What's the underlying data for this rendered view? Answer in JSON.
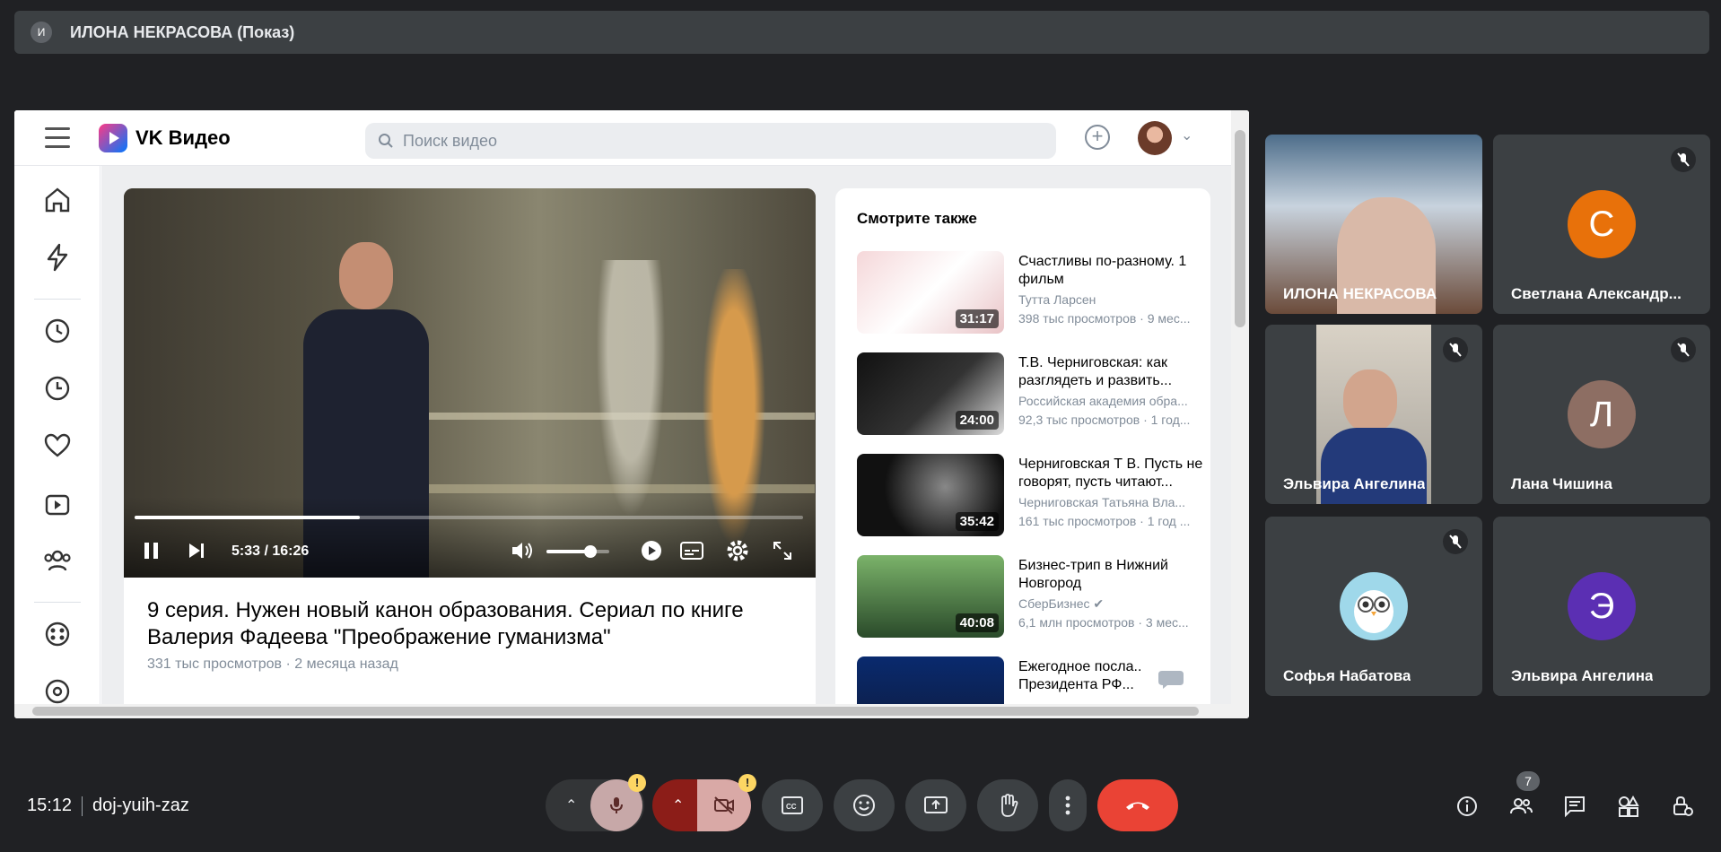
{
  "presenter": {
    "avatar_letter": "И",
    "label": "ИЛОНА НЕКРАСОВА (Показ)"
  },
  "vk": {
    "brand": "VK Видео",
    "search_placeholder": "Поиск видео",
    "player": {
      "time": "5:33 / 16:26",
      "progress_fraction": 0.337,
      "volume_fraction": 0.7
    },
    "video": {
      "title": "9 серия. Нужен новый канон образования. Сериал по книге Валерия Фадеева \"Преображение гуманизма\"",
      "views": "331 тыс просмотров",
      "age": "2 месяца назад"
    },
    "related_heading": "Смотрите также",
    "related": [
      {
        "title": "Счастливы по-разному. 1 фильм",
        "channel": "Тутта Ларсен",
        "stats": "398 тыс просмотров · 9 мес...",
        "duration": "31:17"
      },
      {
        "title": "Т.В. Черниговская: как разглядеть и развить...",
        "channel": "Российская академия обра...",
        "stats": "92,3 тыс просмотров · 1 год...",
        "duration": "24:00"
      },
      {
        "title": "Черниговская Т В. Пусть не говорят, пусть читают...",
        "channel": "Черниговская Татьяна Вла...",
        "stats": "161 тыс просмотров · 1 год ...",
        "duration": "35:42"
      },
      {
        "title": "Бизнес-трип в Нижний Новгород",
        "channel": "СберБизнес ✔",
        "stats": "6,1 млн просмотров · 3 мес...",
        "duration": "40:08"
      },
      {
        "title": "Ежегодное посла... Президента РФ...",
        "channel": "",
        "stats": "",
        "duration": ""
      }
    ]
  },
  "participants": [
    {
      "name": "ИЛОНА НЕКРАСОВА",
      "type": "video",
      "muted": false
    },
    {
      "name": "Светлана Александр...",
      "letter": "С",
      "color": "#e8710a",
      "muted": true
    },
    {
      "name": "Эльвира Ангелина",
      "type": "video",
      "muted": true
    },
    {
      "name": "Лана Чишина",
      "letter": "Л",
      "color": "#8d6e63",
      "muted": true
    },
    {
      "name": "Софья Набатова",
      "type": "owl",
      "muted": true
    },
    {
      "name": "Эльвира Ангелина",
      "letter": "Э",
      "color": "#5b2fb3",
      "muted": false
    }
  ],
  "meeting": {
    "time": "15:12",
    "code": "doj-yuih-zaz",
    "people_count": "7",
    "warn_mark": "!"
  }
}
